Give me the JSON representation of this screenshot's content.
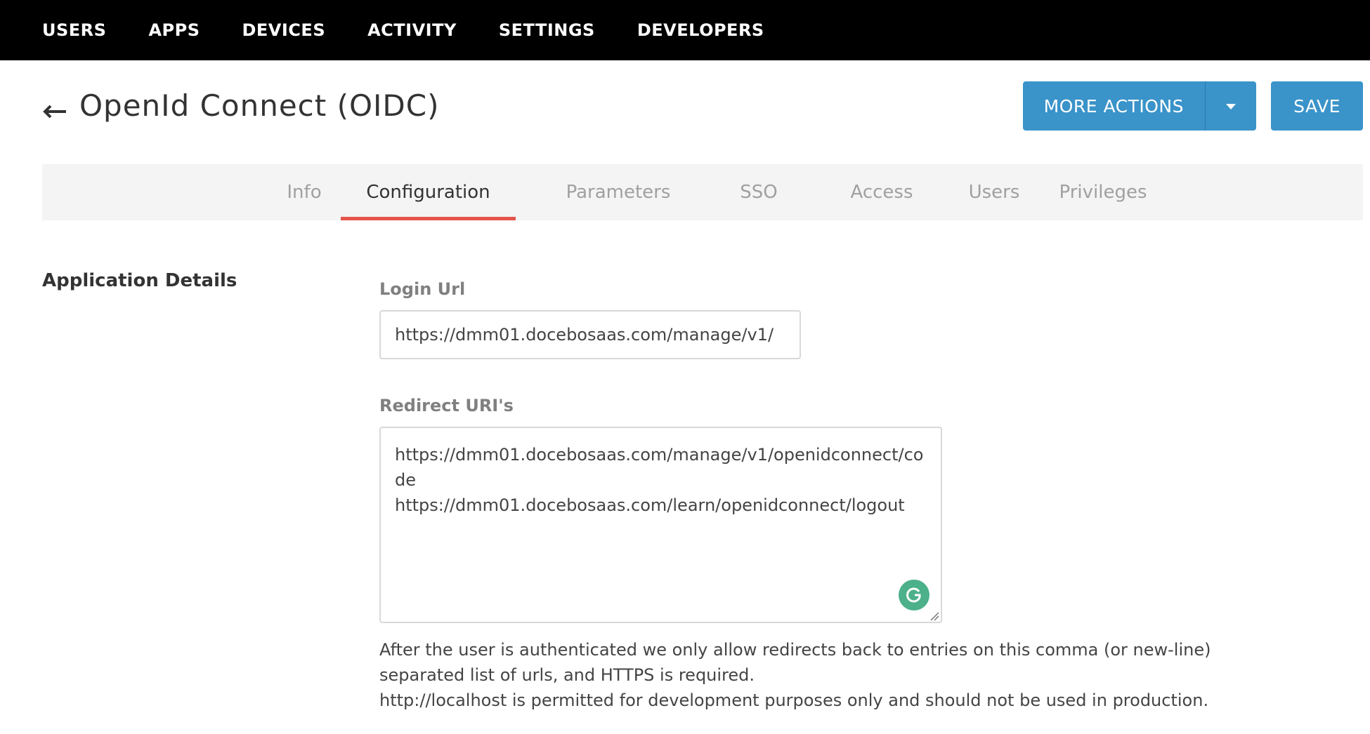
{
  "topnav": {
    "items": [
      "USERS",
      "APPS",
      "DEVICES",
      "ACTIVITY",
      "SETTINGS",
      "DEVELOPERS"
    ]
  },
  "header": {
    "title": "OpenId Connect (OIDC)",
    "more_actions_label": "MORE ACTIONS",
    "save_label": "SAVE"
  },
  "tabs": {
    "items": [
      "Info",
      "Configuration",
      "Parameters",
      "SSO",
      "Access",
      "Users",
      "Privileges"
    ],
    "active": "Configuration"
  },
  "section": {
    "title": "Application Details"
  },
  "fields": {
    "login_url": {
      "label": "Login Url",
      "value": "https://dmm01.docebosaas.com/manage/v1/"
    },
    "redirect_uris": {
      "label": "Redirect URI's",
      "value": "https://dmm01.docebosaas.com/manage/v1/openidconnect/code\nhttps://dmm01.docebosaas.com/learn/openidconnect/logout"
    }
  },
  "help": {
    "line1": "After the user is authenticated we only allow redirects back to entries on this comma (or new-line)",
    "line2": "separated list of urls, and HTTPS is required.",
    "line3": "http://localhost is permitted for development purposes only and should not be used in production."
  },
  "colors": {
    "topnav_bg": "#000000",
    "primary_button": "#3a93c9",
    "active_tab_underline": "#e5534b",
    "tabs_bar_bg": "#f4f4f4",
    "grammarly_badge": "#4cb08b"
  },
  "icons": {
    "back": "arrow-left-icon",
    "dropdown": "caret-down-icon",
    "grammarly": "grammarly-icon",
    "resize": "resize-grip-icon"
  }
}
